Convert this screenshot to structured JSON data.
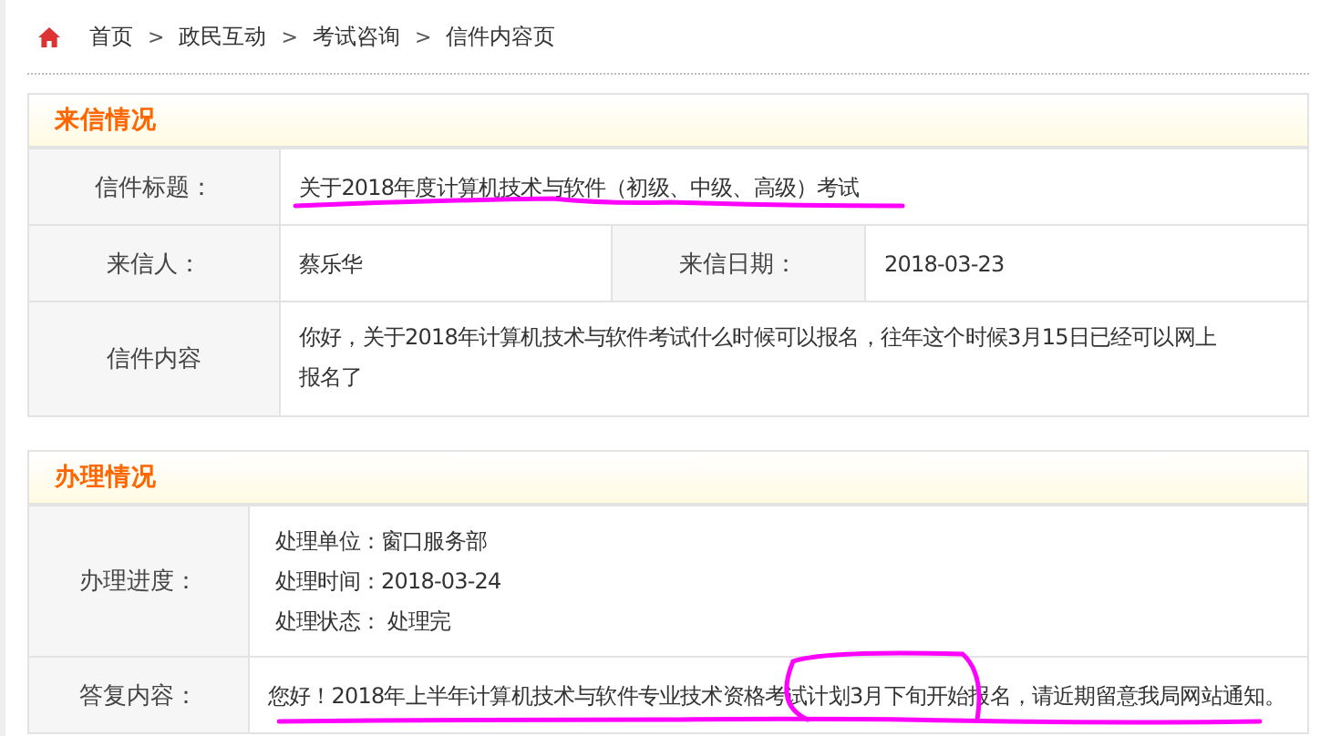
{
  "breadcrumb": {
    "separator": ">",
    "items": [
      {
        "label": "首页"
      },
      {
        "label": "政民互动"
      },
      {
        "label": "考试咨询"
      },
      {
        "label": "信件内容页"
      }
    ]
  },
  "panels": [
    {
      "title": "来信情况",
      "rows": [
        {
          "fields": [
            {
              "label": "信件标题：",
              "value": "关于2018年度计算机技术与软件（初级、中级、高级）考试"
            }
          ]
        },
        {
          "fields": [
            {
              "label": "来信人：",
              "value": "蔡乐华"
            },
            {
              "label": "来信日期：",
              "value": "2018-03-23"
            }
          ]
        },
        {
          "fields": [
            {
              "label": "信件内容",
              "value": "你好，关于2018年计算机技术与软件考试什么时候可以报名，往年这个时候3月15日已经可以网上报名了"
            }
          ]
        }
      ]
    },
    {
      "title": "办理情况",
      "rows": [
        {
          "fields": [
            {
              "label": "办理进度：",
              "lines": [
                "处理单位：窗口服务部",
                "处理时间：2018-03-24",
                "处理状态： 处理完"
              ]
            }
          ]
        },
        {
          "fields": [
            {
              "label": "答复内容：",
              "value": "您好！2018年上半年计算机技术与软件专业技术资格考试计划3月下旬开始报名，请近期留意我局网站通知。"
            }
          ]
        }
      ]
    }
  ]
}
